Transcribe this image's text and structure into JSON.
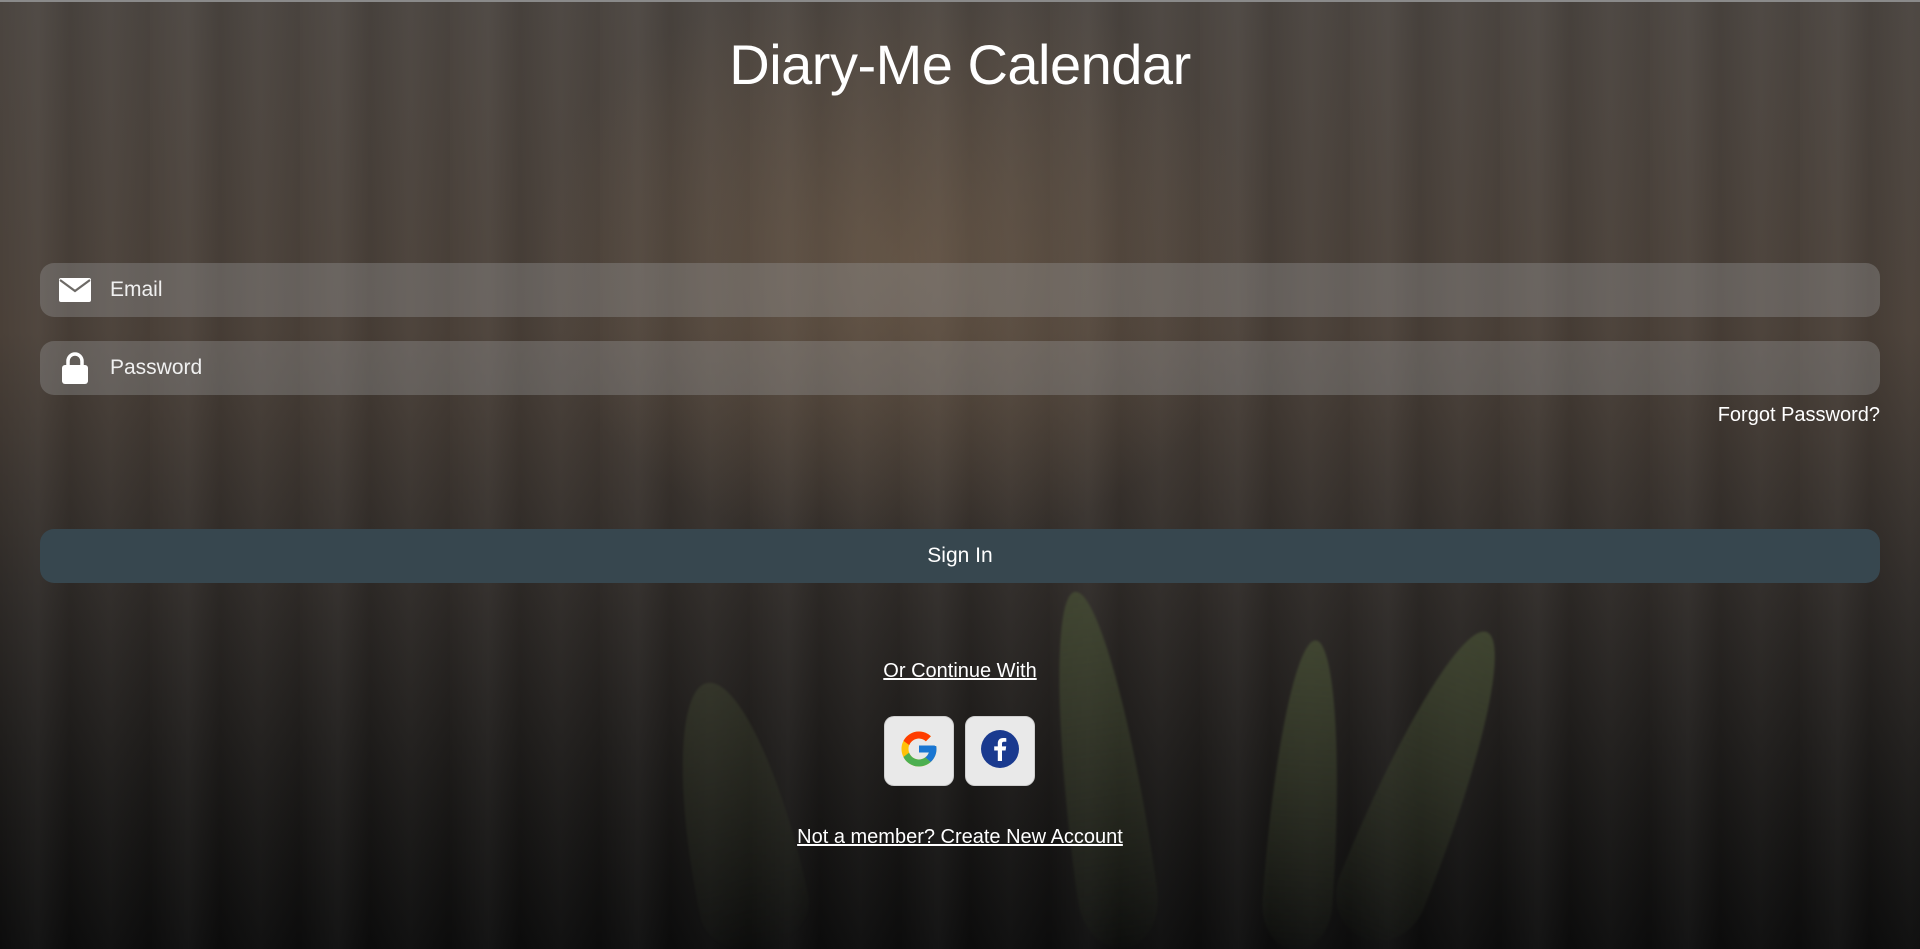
{
  "app": {
    "title": "Diary-Me Calendar"
  },
  "login_form": {
    "email": {
      "placeholder": "Email",
      "value": "",
      "icon": "envelope-icon"
    },
    "password": {
      "placeholder": "Password",
      "value": "",
      "icon": "lock-icon"
    },
    "forgot_password_label": "Forgot Password?",
    "sign_in_label": "Sign In"
  },
  "social_login": {
    "heading": "Or Continue With",
    "providers": [
      {
        "name": "google-icon"
      },
      {
        "name": "facebook-icon"
      }
    ]
  },
  "register": {
    "label": "Not a member? Create New Account"
  },
  "colors": {
    "sign_in_button": "#37474f",
    "field_background": "rgba(150,150,150,0.38)",
    "facebook_blue": "#1a3a8f"
  }
}
